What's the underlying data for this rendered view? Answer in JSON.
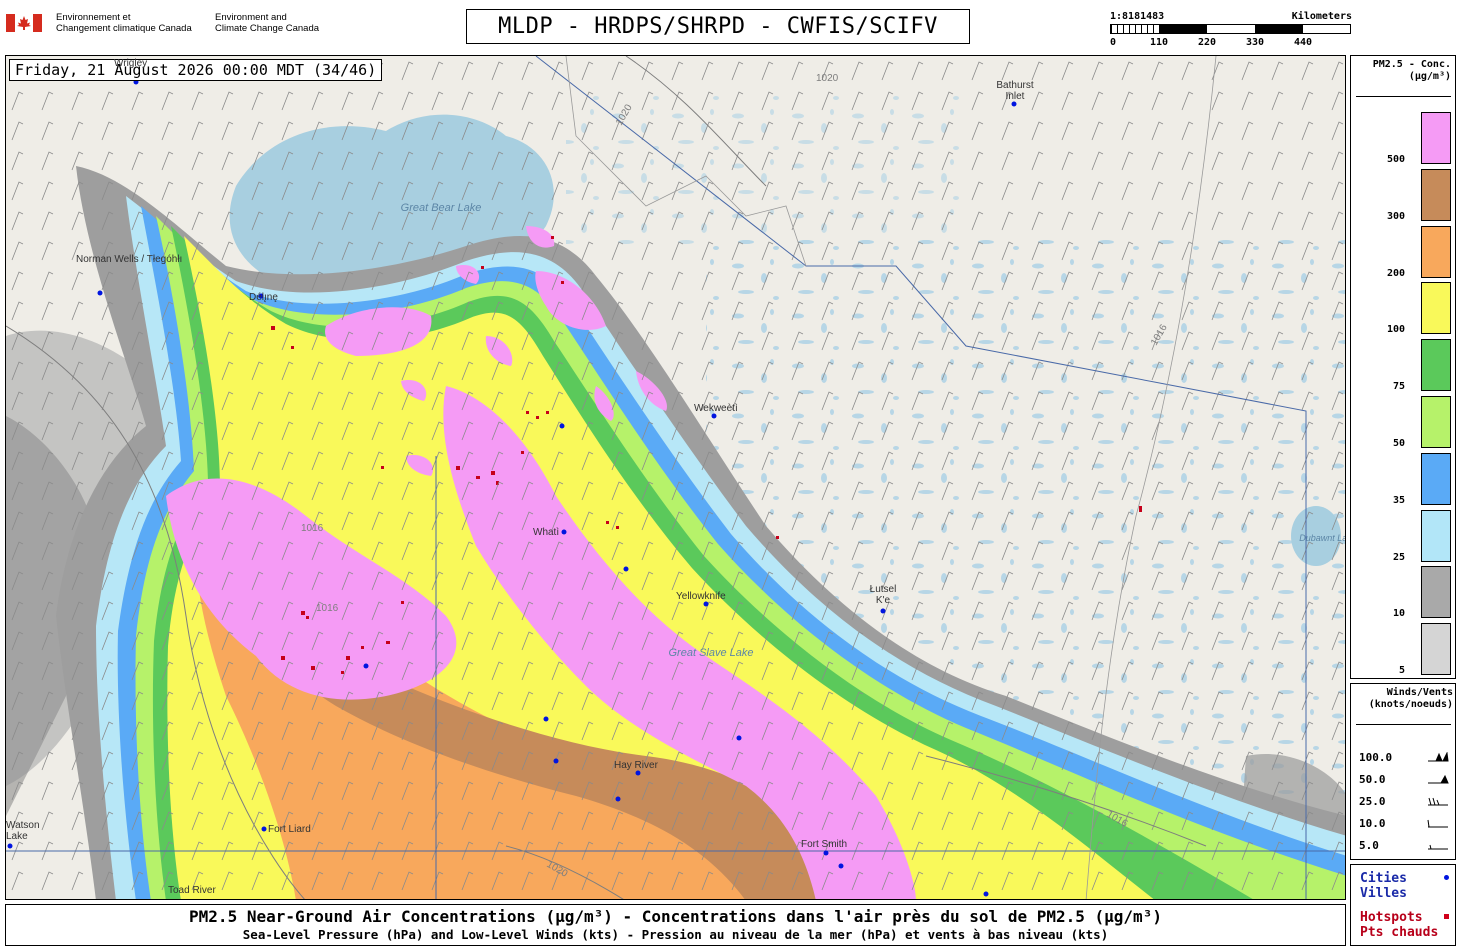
{
  "header": {
    "org_fr": [
      "Environnement et",
      "Changement climatique Canada"
    ],
    "org_en": [
      "Environment and",
      "Climate Change Canada"
    ],
    "title": "MLDP - HRDPS/SHRPD - CWFIS/SCIFV"
  },
  "scale": {
    "ratio": "1:8181483",
    "units": "Kilometers",
    "ticks": [
      "0",
      "110",
      "220",
      "330",
      "440"
    ]
  },
  "map": {
    "timestamp": "Friday, 21 August 2026 00:00 MDT (34/46)",
    "lakes": [
      "Great Bear Lake",
      "Great Slave Lake",
      "Dubawnt Lake"
    ],
    "cities": [
      {
        "name": "Norman Wells / Tłegóhłı"
      },
      {
        "name": "Délı̨nę"
      },
      {
        "name": "Bathurst Inlet"
      },
      {
        "name": "Wekweètì"
      },
      {
        "name": "Whatì"
      },
      {
        "name": "Yellowknife"
      },
      {
        "name": "Łutsel K'e"
      },
      {
        "name": "Fort Smith"
      },
      {
        "name": "Hay River"
      },
      {
        "name": "Fort Liard"
      },
      {
        "name": "Toad River"
      },
      {
        "name": "Watson Lake"
      },
      {
        "name": "Wrigley"
      }
    ],
    "isobar_labels": [
      "1020",
      "1016"
    ]
  },
  "legend": {
    "title": [
      "PM2.5 - Conc.",
      "(µg/m³)"
    ],
    "bins": [
      {
        "label": "500",
        "color": "#f59bf5"
      },
      {
        "label": "300",
        "color": "#c68b5a"
      },
      {
        "label": "200",
        "color": "#f8a85c"
      },
      {
        "label": "100",
        "color": "#f9f95a"
      },
      {
        "label": "75",
        "color": "#5bc95b"
      },
      {
        "label": "50",
        "color": "#b6f26a"
      },
      {
        "label": "35",
        "color": "#5aaaf6"
      },
      {
        "label": "25",
        "color": "#b2e6f8"
      },
      {
        "label": "10",
        "color": "#a9a9a9"
      },
      {
        "label": "5",
        "color": "#d5d5d5"
      }
    ]
  },
  "wind_legend": {
    "title": [
      "Winds/Vents",
      "(knots/noeuds)"
    ],
    "rows": [
      "100.0",
      "50.0",
      "25.0",
      "10.0",
      "5.0"
    ]
  },
  "keys": {
    "cities": [
      "Cities",
      "Villes"
    ],
    "hotspots": [
      "Hotspots",
      "Pts chauds"
    ],
    "city_color": "#0015e0",
    "hotspot_color": "#d0001a"
  },
  "footer": {
    "line1": "PM2.5 Near-Ground Air Concentrations (µg/m³) - Concentrations dans l'air près du sol de PM2.5 (µg/m³)",
    "line2": "Sea-Level Pressure (hPa) and Low-Level Winds (kts) - Pression au niveau de la mer (hPa) et vents à bas niveau (kts)"
  }
}
